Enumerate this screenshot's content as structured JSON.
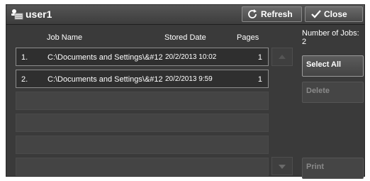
{
  "header": {
    "title": "user1",
    "refresh_label": "Refresh",
    "close_label": "Close"
  },
  "columns": {
    "job_name": "Job Name",
    "stored_date": "Stored Date",
    "pages": "Pages"
  },
  "jobs_count": {
    "label": "Number of Jobs:",
    "value": "2"
  },
  "jobs": [
    {
      "num": "1.",
      "name": "C:\\Documents and Settings\\&#12",
      "date": "20/2/2013 10:02",
      "pages": "1"
    },
    {
      "num": "2.",
      "name": "C:\\Documents and Settings\\&#12",
      "date": "20/2/2013 9:59",
      "pages": "1"
    }
  ],
  "actions": {
    "select_all": "Select All",
    "delete": "Delete",
    "print": "Print"
  },
  "icons": {
    "user": "user-folder-icon",
    "refresh": "refresh-icon",
    "close": "checkmark-icon",
    "scroll_up": "triangle-up-icon",
    "scroll_down": "triangle-down-icon"
  }
}
